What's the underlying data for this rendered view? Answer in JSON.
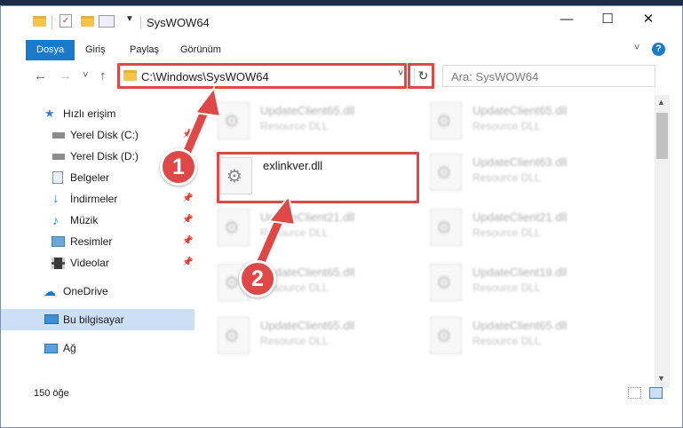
{
  "window": {
    "title": "SysWOW64",
    "controls": {
      "minimize": "—",
      "maximize": "☐",
      "close": "✕"
    }
  },
  "ribbon": {
    "tabs": [
      {
        "label": "Dosya",
        "active": true
      },
      {
        "label": "Giriş"
      },
      {
        "label": "Paylaş"
      },
      {
        "label": "Görünüm"
      }
    ],
    "expand_icon": "chevron-down-icon",
    "help": "?"
  },
  "nav": {
    "back": "←",
    "forward": "→",
    "recent": "˅",
    "up": "↑",
    "address": "C:\\Windows\\SysWOW64",
    "dropdown": "˅",
    "refresh": "↻",
    "search_placeholder": "Ara: SysWOW64"
  },
  "sidebar": {
    "items": [
      {
        "label": "Hızlı erişim",
        "icon": "star-icon"
      },
      {
        "label": "Yerel Disk (C:)",
        "icon": "drive-icon",
        "pinned": true
      },
      {
        "label": "Yerel Disk (D:)",
        "icon": "drive-icon"
      },
      {
        "label": "Belgeler",
        "icon": "documents-icon",
        "pinned": true
      },
      {
        "label": "İndirmeler",
        "icon": "download-icon",
        "pinned": true
      },
      {
        "label": "Müzik",
        "icon": "music-icon",
        "pinned": true
      },
      {
        "label": "Resimler",
        "icon": "pictures-icon",
        "pinned": true
      },
      {
        "label": "Videolar",
        "icon": "videos-icon",
        "pinned": true
      },
      {
        "label": "OneDrive",
        "icon": "cloud-icon"
      },
      {
        "label": "Bu bilgisayar",
        "icon": "computer-icon",
        "selected": true
      },
      {
        "label": "Ağ",
        "icon": "network-icon"
      }
    ],
    "pin_glyph": "📌"
  },
  "files": {
    "main": {
      "name": "exlinkver.dll"
    },
    "background": [
      {
        "name": "UpdateClient65.dll",
        "type": "Resource DLL"
      },
      {
        "name": "UpdateClient65.dll",
        "type": "Resource DLL"
      },
      {
        "name": "UpdateClient63.dll",
        "type": "Resource DLL"
      },
      {
        "name": "UpdateClient21.dll",
        "type": "Resource DLL"
      },
      {
        "name": "UpdateClient21.dll",
        "type": "Resource DLL"
      },
      {
        "name": "UpdateClient65.dll",
        "type": "Resource DLL"
      },
      {
        "name": "UpdateClient19.dll",
        "type": "Resource DLL"
      },
      {
        "name": "UpdateClient65.dll",
        "type": "Resource DLL"
      },
      {
        "name": "UpdateClient65.dll",
        "type": "Resource DLL"
      }
    ]
  },
  "status": {
    "count": "150 öğe"
  },
  "annotations": {
    "step1": "1",
    "step2": "2",
    "color": "#e04848"
  }
}
